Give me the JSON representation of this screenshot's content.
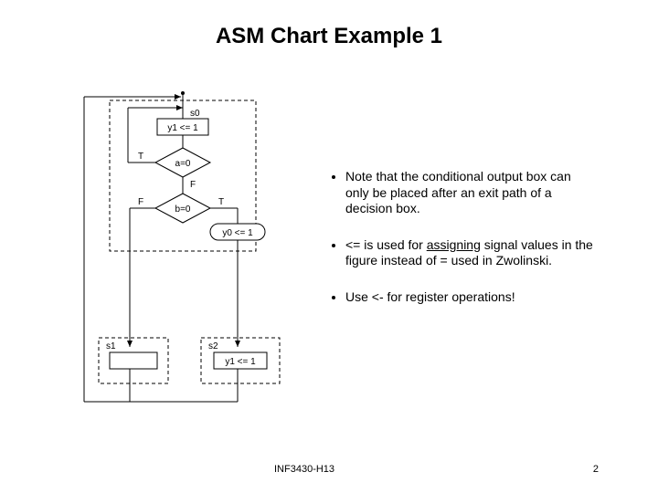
{
  "title": "ASM Chart Example 1",
  "diagram": {
    "state_label_s0": "s0",
    "state_box_s0": "y1 <= 1",
    "decision_a": "a=0",
    "decision_b": "b=0",
    "cond_output": "y0 <= 1",
    "state_label_s1": "s1",
    "state_box_s1": "",
    "state_label_s2": "s2",
    "state_box_s2": "y1 <= 1",
    "true_label": "T",
    "false_label": "F",
    "edge_T_1": "T",
    "edge_F_1": "F",
    "edge_T_2": "T",
    "edge_F_2": "F"
  },
  "bullets": {
    "b1": "Note that the conditional output box can only be placed after an exit path of a decision box.",
    "b2_pre": "<= is used for ",
    "b2_mid": "assigning",
    "b2_post": " signal values in the figure instead of = used in Zwolinski.",
    "b3": "Use <- for register operations!"
  },
  "footer": {
    "left": "INF3430-H13",
    "right": "2"
  }
}
